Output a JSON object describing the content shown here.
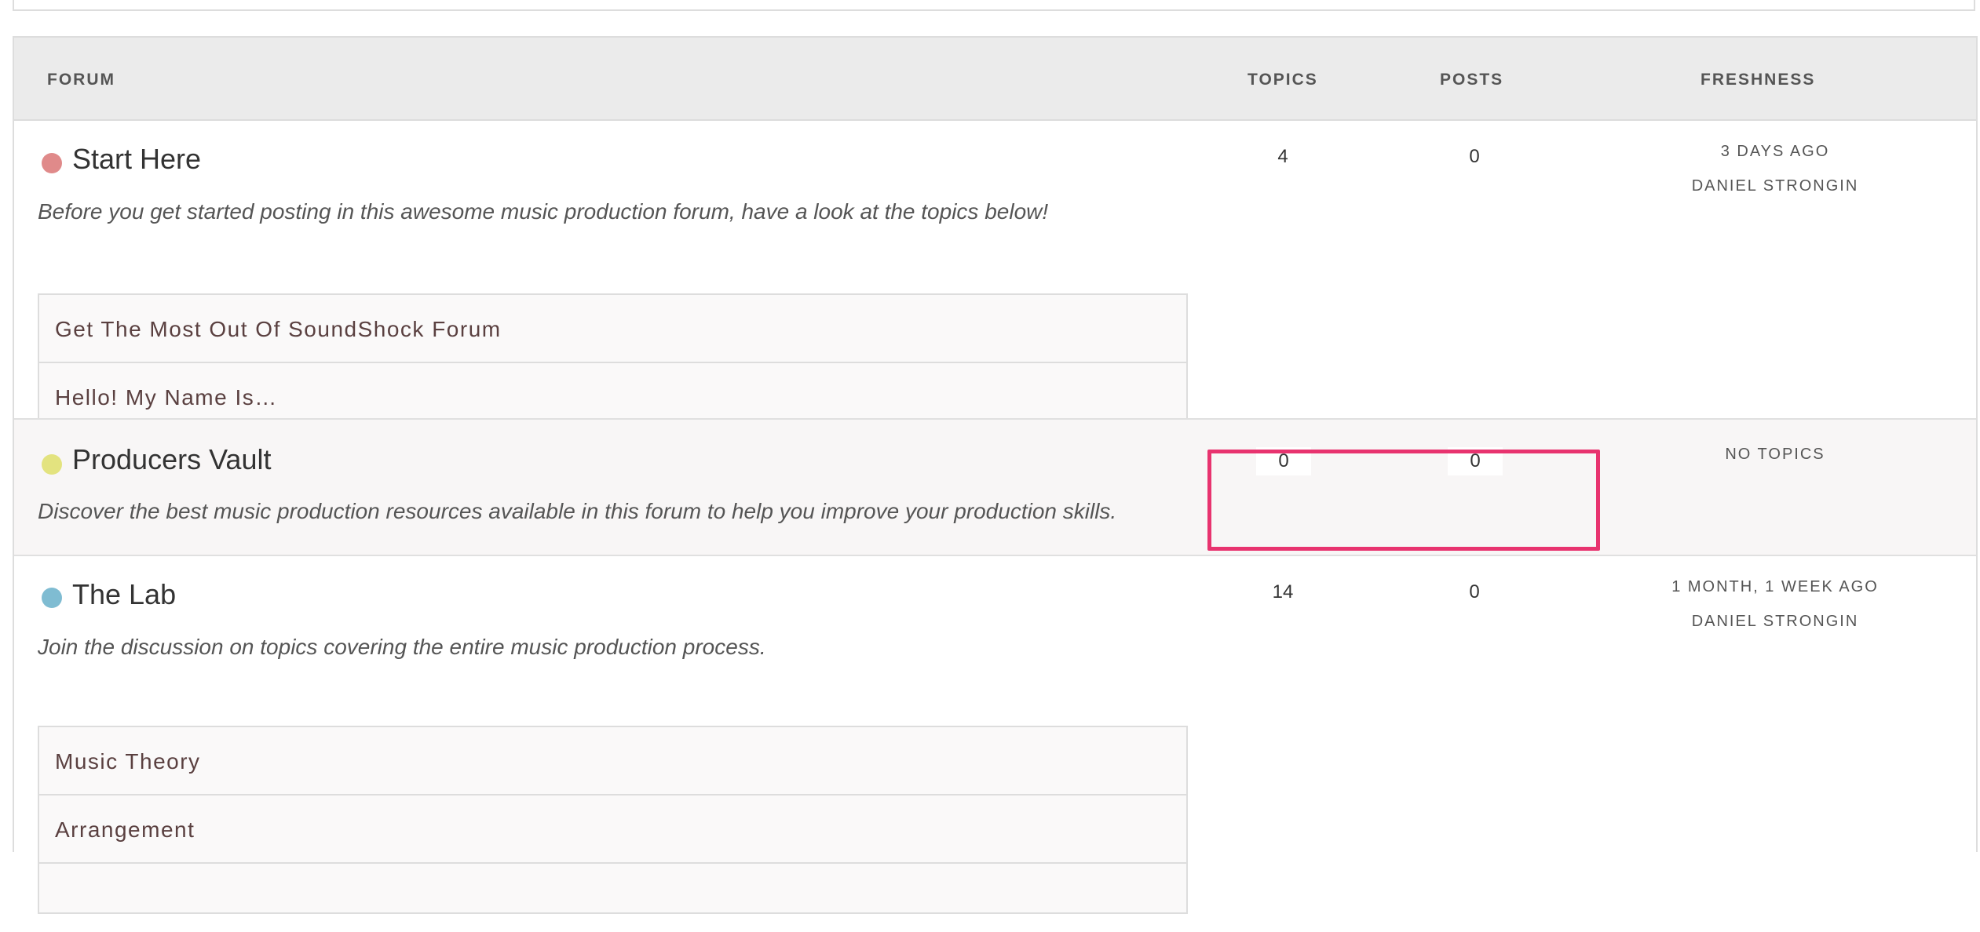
{
  "header": {
    "forum": "FORUM",
    "topics": "TOPICS",
    "posts": "POSTS",
    "freshness": "FRESHNESS"
  },
  "forums": [
    {
      "title": "Start Here",
      "description": "Before you get started posting in this awesome music production forum, have a look at the topics below!",
      "dot_color": "#e08a8a",
      "topics": "4",
      "posts": "0",
      "freshness_time": "3 DAYS AGO",
      "freshness_author": "DANIEL STRONGIN",
      "subforums": [
        "Get The Most Out Of SoundShock Forum",
        "Hello! My Name Is…"
      ]
    },
    {
      "title": "Producers Vault",
      "description": "Discover the best music production resources available in this forum to help you improve your production skills.",
      "dot_color": "#e3e37f",
      "topics": "0",
      "posts": "0",
      "freshness_time": "NO TOPICS"
    },
    {
      "title": "The Lab",
      "description": "Join the discussion on topics covering the entire music production process.",
      "dot_color": "#7fbcd2",
      "topics": "14",
      "posts": "0",
      "freshness_time": "1 MONTH, 1 WEEK AGO",
      "freshness_author": "DANIEL STRONGIN",
      "subforums": [
        "Music Theory",
        "Arrangement"
      ]
    }
  ],
  "highlight_color": "#e8336f"
}
